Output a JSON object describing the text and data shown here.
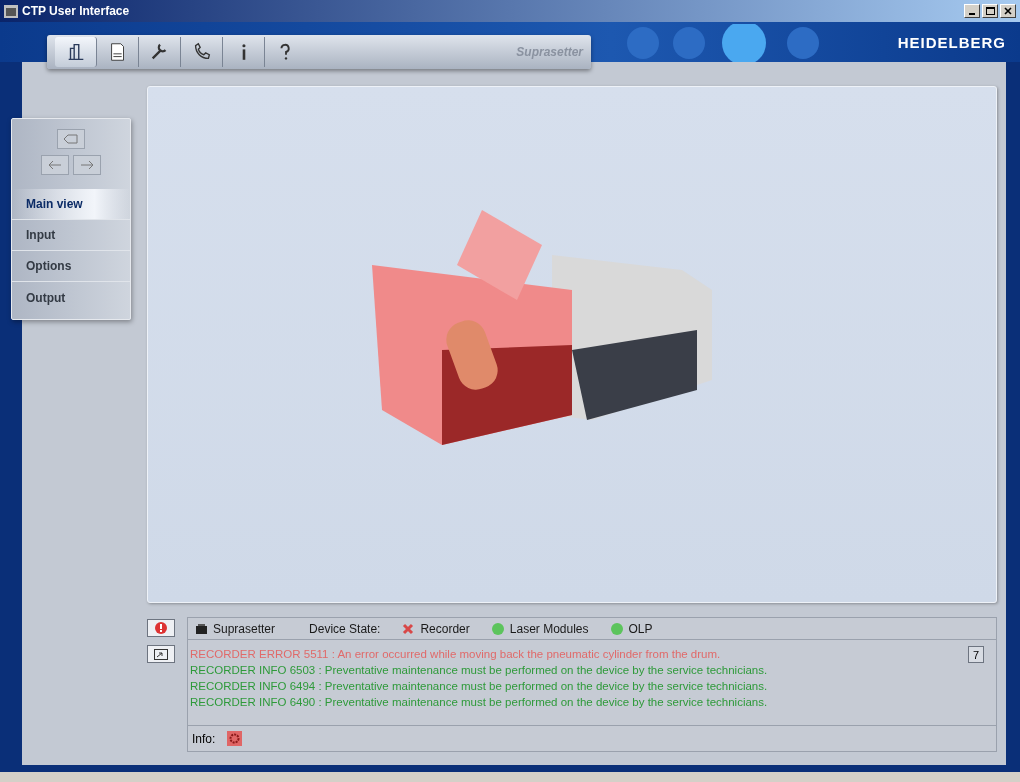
{
  "window": {
    "title": "CTP User Interface"
  },
  "toolbar": {
    "items": [
      {
        "kind": "device",
        "selected": true
      },
      {
        "kind": "document",
        "selected": false
      },
      {
        "kind": "wrench",
        "selected": false
      },
      {
        "kind": "phone",
        "selected": false
      },
      {
        "kind": "info",
        "selected": false
      },
      {
        "kind": "help",
        "selected": false
      }
    ],
    "label": "Suprasetter"
  },
  "logo": "HEIDELBERG",
  "nav": {
    "items": [
      {
        "label": "Main view",
        "selected": true
      },
      {
        "label": "Input",
        "selected": false
      },
      {
        "label": "Options",
        "selected": false
      },
      {
        "label": "Output",
        "selected": false
      }
    ]
  },
  "status": {
    "device": "Suprasetter",
    "state_label": "Device State:",
    "states": [
      {
        "label": "Recorder",
        "error": true
      },
      {
        "label": "Laser Modules",
        "error": false
      },
      {
        "label": "OLP",
        "error": false
      }
    ],
    "messages": [
      {
        "text": "RECORDER ERROR 5511 : An error occurred while moving back the pneumatic cylinder from the drum.",
        "kind": "error"
      },
      {
        "text": "RECORDER INFO 6503 : Preventative maintenance must be performed on the device by the service technicians.",
        "kind": "info"
      },
      {
        "text": "RECORDER INFO 6494 : Preventative maintenance must be performed on the device by the service technicians.",
        "kind": "info"
      },
      {
        "text": "RECORDER INFO 6490 : Preventative maintenance must be performed on the device by the service technicians.",
        "kind": "info"
      }
    ],
    "count": "7",
    "info_label": "Info:"
  }
}
